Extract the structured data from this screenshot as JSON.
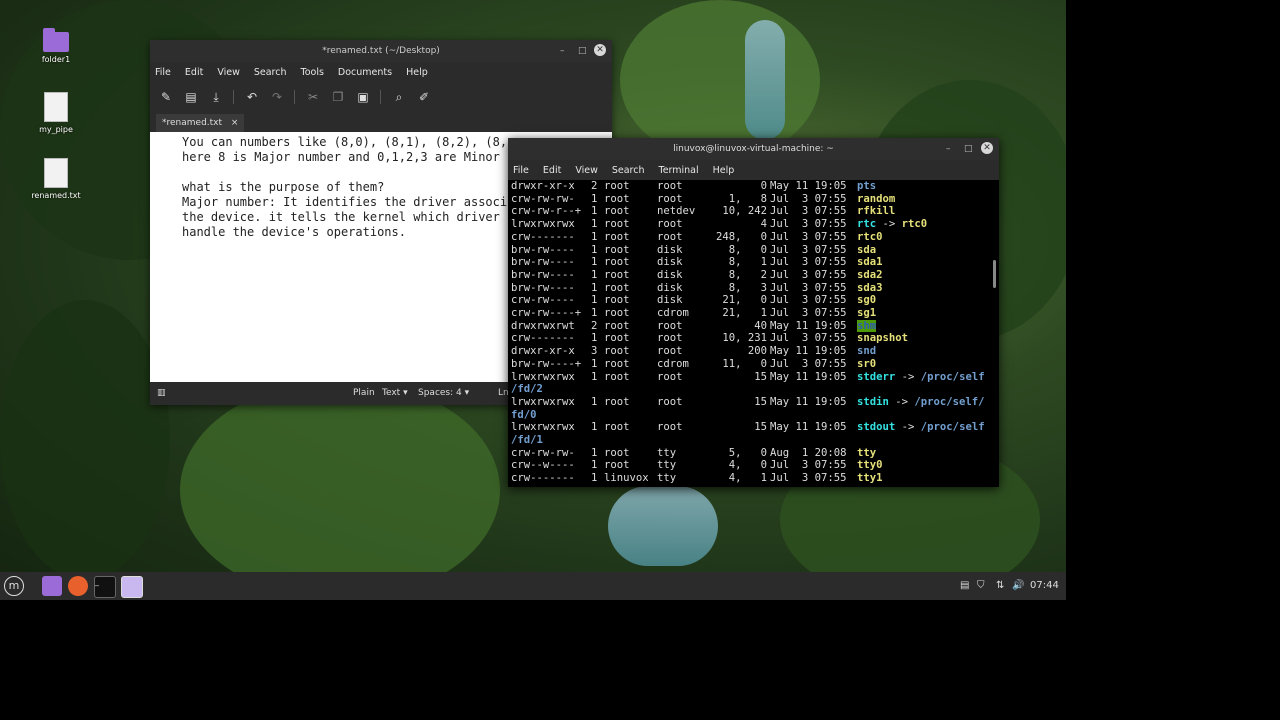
{
  "desktop": {
    "icons": [
      {
        "label": "folder1",
        "type": "folder"
      },
      {
        "label": "my_pipe",
        "type": "file"
      },
      {
        "label": "renamed.txt",
        "type": "file"
      }
    ]
  },
  "editor": {
    "title": "*renamed.txt (~/Desktop)",
    "menu": [
      "File",
      "Edit",
      "View",
      "Search",
      "Tools",
      "Documents",
      "Help"
    ],
    "toolbar_icons": [
      "new-document-icon",
      "open-icon",
      "save-icon",
      "undo-icon",
      "redo-icon",
      "cut-icon",
      "copy-icon",
      "paste-icon",
      "find-icon",
      "tools-icon"
    ],
    "tab_label": "*renamed.txt",
    "tab_close": "×",
    "lines": [
      "You can numbers like (8,0), (8,1), (8,2), (8,",
      "here 8 is Major number and 0,1,2,3 are Minor",
      "",
      "what is the purpose of them?",
      "Major number: It identifies the driver associ",
      "the device. it tells the kernel which driver",
      "handle the device's operations."
    ],
    "status": {
      "lang": "Plain",
      "text": "Text",
      "spaces_label": "Spaces:",
      "spaces_value": "4",
      "position": "Ln"
    }
  },
  "terminal": {
    "title": "linuvox@linuvox-virtual-machine: ~",
    "menu": [
      "File",
      "Edit",
      "View",
      "Search",
      "Terminal",
      "Help"
    ],
    "rows": [
      {
        "perm": "drwxr-xr-x",
        "links": "2",
        "owner": "root",
        "group": "root",
        "size": "0",
        "date": "May 11 19:05",
        "name": "pts",
        "kind": "dir"
      },
      {
        "perm": "crw-rw-rw-",
        "links": "1",
        "owner": "root",
        "group": "root",
        "size": "1,   8",
        "date": "Jul  3 07:55",
        "name": "random",
        "kind": "dev"
      },
      {
        "perm": "crw-rw-r--+",
        "links": "1",
        "owner": "root",
        "group": "netdev",
        "size": "10, 242",
        "date": "Jul  3 07:55",
        "name": "rfkill",
        "kind": "dev"
      },
      {
        "perm": "lrwxrwxrwx",
        "links": "1",
        "owner": "root",
        "group": "root",
        "size": "4",
        "date": "Jul  3 07:55",
        "name": "rtc",
        "kind": "lnk",
        "target": "rtc0",
        "target_kind": "dev"
      },
      {
        "perm": "crw-------",
        "links": "1",
        "owner": "root",
        "group": "root",
        "size": "248,   0",
        "date": "Jul  3 07:55",
        "name": "rtc0",
        "kind": "dev"
      },
      {
        "perm": "brw-rw----",
        "links": "1",
        "owner": "root",
        "group": "disk",
        "size": "8,   0",
        "date": "Jul  3 07:55",
        "name": "sda",
        "kind": "dev"
      },
      {
        "perm": "brw-rw----",
        "links": "1",
        "owner": "root",
        "group": "disk",
        "size": "8,   1",
        "date": "Jul  3 07:55",
        "name": "sda1",
        "kind": "dev"
      },
      {
        "perm": "brw-rw----",
        "links": "1",
        "owner": "root",
        "group": "disk",
        "size": "8,   2",
        "date": "Jul  3 07:55",
        "name": "sda2",
        "kind": "dev"
      },
      {
        "perm": "brw-rw----",
        "links": "1",
        "owner": "root",
        "group": "disk",
        "size": "8,   3",
        "date": "Jul  3 07:55",
        "name": "sda3",
        "kind": "dev"
      },
      {
        "perm": "crw-rw----",
        "links": "1",
        "owner": "root",
        "group": "disk",
        "size": "21,   0",
        "date": "Jul  3 07:55",
        "name": "sg0",
        "kind": "dev"
      },
      {
        "perm": "crw-rw----+",
        "links": "1",
        "owner": "root",
        "group": "cdrom",
        "size": "21,   1",
        "date": "Jul  3 07:55",
        "name": "sg1",
        "kind": "dev"
      },
      {
        "perm": "drwxrwxrwt",
        "links": "2",
        "owner": "root",
        "group": "root",
        "size": "40",
        "date": "May 11 19:05",
        "name": "shm",
        "kind": "shm"
      },
      {
        "perm": "crw-------",
        "links": "1",
        "owner": "root",
        "group": "root",
        "size": "10, 231",
        "date": "Jul  3 07:55",
        "name": "snapshot",
        "kind": "dev"
      },
      {
        "perm": "drwxr-xr-x",
        "links": "3",
        "owner": "root",
        "group": "root",
        "size": "200",
        "date": "May 11 19:05",
        "name": "snd",
        "kind": "dir"
      },
      {
        "perm": "brw-rw----+",
        "links": "1",
        "owner": "root",
        "group": "cdrom",
        "size": "11,   0",
        "date": "Jul  3 07:55",
        "name": "sr0",
        "kind": "dev"
      },
      {
        "perm": "lrwxrwxrwx",
        "links": "1",
        "owner": "root",
        "group": "root",
        "size": "15",
        "date": "May 11 19:05",
        "name": "stderr",
        "kind": "lnk",
        "target": "/proc/self",
        "target_cont": "/fd/2",
        "target_kind": "dir"
      },
      {
        "perm": "lrwxrwxrwx",
        "links": "1",
        "owner": "root",
        "group": "root",
        "size": "15",
        "date": "May 11 19:05",
        "name": "stdin",
        "kind": "lnk",
        "target": "/proc/self/",
        "target_cont": "fd/0",
        "target_kind": "dir"
      },
      {
        "perm": "lrwxrwxrwx",
        "links": "1",
        "owner": "root",
        "group": "root",
        "size": "15",
        "date": "May 11 19:05",
        "name": "stdout",
        "kind": "lnk",
        "target": "/proc/self",
        "target_cont": "/fd/1",
        "target_kind": "dir"
      },
      {
        "perm": "crw-rw-rw-",
        "links": "1",
        "owner": "root",
        "group": "tty",
        "size": "5,   0",
        "date": "Aug  1 20:08",
        "name": "tty",
        "kind": "dev"
      },
      {
        "perm": "crw--w----",
        "links": "1",
        "owner": "root",
        "group": "tty",
        "size": "4,   0",
        "date": "Jul  3 07:55",
        "name": "tty0",
        "kind": "dev"
      },
      {
        "perm": "crw-------",
        "links": "1",
        "owner": "linuvox",
        "group": "tty",
        "size": "4,   1",
        "date": "Jul  3 07:55",
        "name": "tty1",
        "kind": "dev"
      }
    ]
  },
  "taskbar": {
    "apps": [
      "menu-icon",
      "files-icon",
      "firefox-icon",
      "terminal-icon",
      "text-editor-icon"
    ],
    "clock": "07:44"
  }
}
